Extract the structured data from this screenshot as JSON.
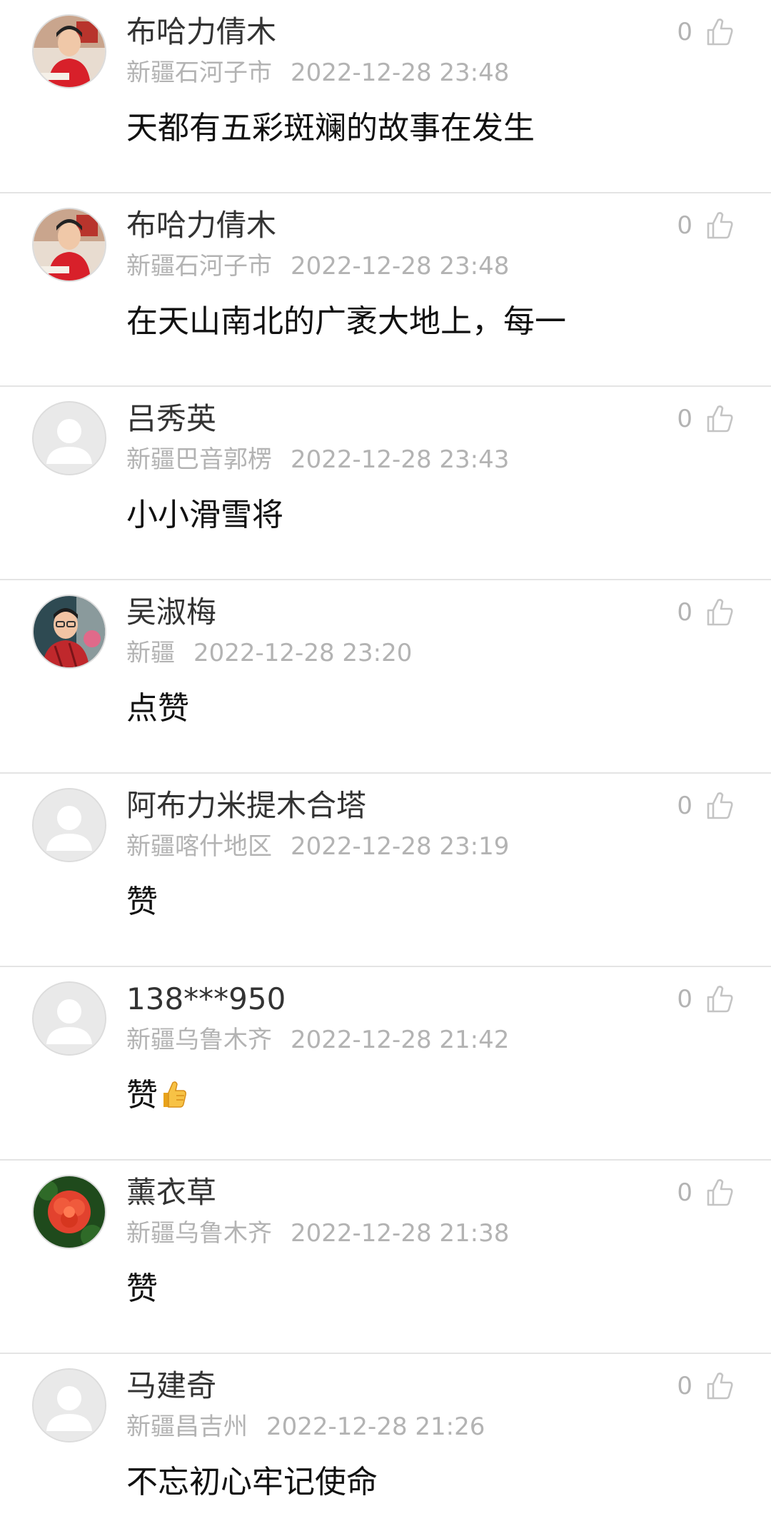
{
  "comments": [
    {
      "name": "布哈力倩木",
      "location": "新疆石河子市",
      "time": "2022-12-28  23:48",
      "text": "天都有五彩斑斓的故事在发生",
      "likes": "0",
      "avatar": "photo-person-red"
    },
    {
      "name": "布哈力倩木",
      "location": "新疆石河子市",
      "time": "2022-12-28  23:48",
      "text": "在天山南北的广袤大地上，每一",
      "likes": "0",
      "avatar": "photo-person-red"
    },
    {
      "name": "吕秀英",
      "location": "新疆巴音郭楞",
      "time": "2022-12-28  23:43",
      "text": "小小滑雪将",
      "likes": "0",
      "avatar": "default-user"
    },
    {
      "name": "吴淑梅",
      "location": "新疆",
      "time": "2022-12-28  23:20",
      "text": "点赞",
      "likes": "0",
      "avatar": "photo-person-glasses"
    },
    {
      "name": "阿布力米提木合塔",
      "location": "新疆喀什地区",
      "time": "2022-12-28  23:19",
      "text": "赞",
      "likes": "0",
      "avatar": "default-user"
    },
    {
      "name": "138***950",
      "location": "新疆乌鲁木齐",
      "time": "2022-12-28  21:42",
      "text": "赞",
      "likes": "0",
      "avatar": "default-user",
      "emoji": "thumbs-up-emoji"
    },
    {
      "name": "薰衣草",
      "location": "新疆乌鲁木齐",
      "time": "2022-12-28  21:38",
      "text": "赞",
      "likes": "0",
      "avatar": "photo-red-flower"
    },
    {
      "name": "马建奇",
      "location": "新疆昌吉州",
      "time": "2022-12-28  21:26",
      "text": "不忘初心牢记使命",
      "likes": "0",
      "avatar": "default-user"
    }
  ],
  "colors": {
    "name": "#333333",
    "meta": "#b3b3b3",
    "text": "#111111",
    "divider": "#e4e4e4",
    "icon": "#c4c4c4"
  },
  "icons": {
    "like": "thumbs-up-outline-icon",
    "default_avatar": "default-user-icon"
  }
}
